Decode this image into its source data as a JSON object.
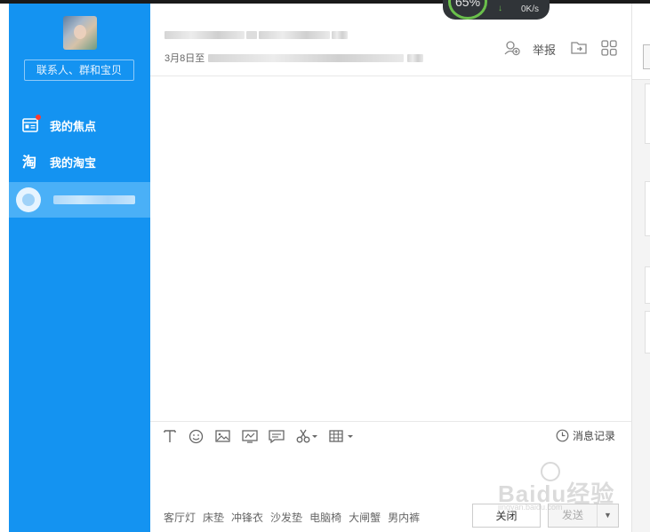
{
  "sidebar": {
    "contacts_button": "联系人、群和宝贝",
    "items": [
      {
        "label": "我的焦点",
        "icon": "focus-card-icon"
      },
      {
        "label": "我的淘宝",
        "icon": "taobao-icon"
      }
    ]
  },
  "header": {
    "date_text": "3月8日至",
    "report_label": "举报"
  },
  "net_speed": {
    "percent": "65%",
    "rate": "0K/s"
  },
  "toolbar": {
    "message_record": "消息记录"
  },
  "suggestions": [
    "客厅灯",
    "床垫",
    "冲锋衣",
    "沙发垫",
    "电脑椅",
    "大闸蟹",
    "男内裤"
  ],
  "buttons": {
    "close": "关闭",
    "send": "发送"
  },
  "watermark": {
    "text": "Baidu经验",
    "sub": "jingyan.baidu.com"
  },
  "colors": {
    "sidebar": "#1493f1",
    "active_item": "#4ab0f7"
  }
}
